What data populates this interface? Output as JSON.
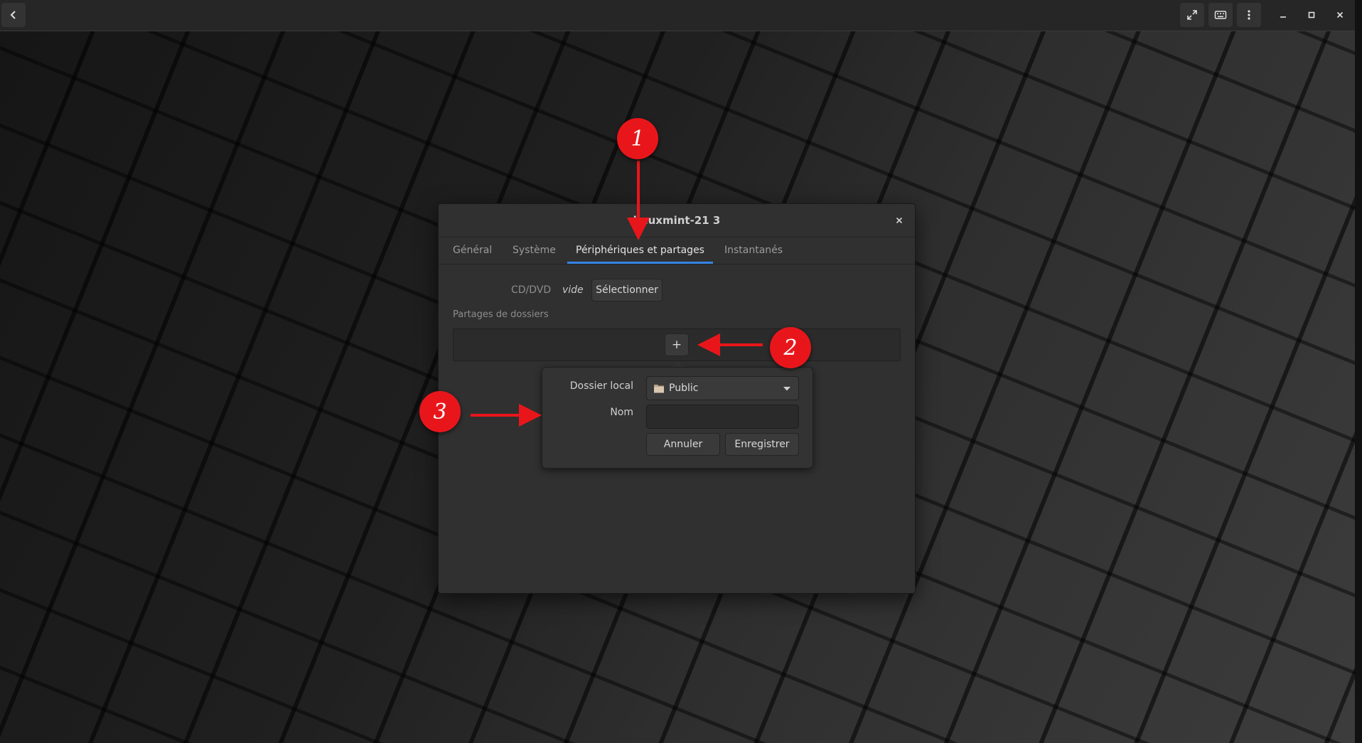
{
  "window": {
    "title": "linuxmint-21 3",
    "close_icon": "close-icon"
  },
  "tabs": [
    {
      "label": "Général",
      "active": false
    },
    {
      "label": "Système",
      "active": false
    },
    {
      "label": "Périphériques et partages",
      "active": true
    },
    {
      "label": "Instantanés",
      "active": false
    }
  ],
  "devices": {
    "cd_label": "CD/DVD",
    "cd_value": "vide",
    "select_button": "Sélectionner",
    "shares_heading": "Partages de dossiers",
    "add_button": "+"
  },
  "share_popover": {
    "local_folder_label": "Dossier local",
    "local_folder_value": "Public",
    "name_label": "Nom",
    "name_value": "",
    "cancel_button": "Annuler",
    "save_button": "Enregistrer"
  },
  "callouts": [
    "1",
    "2",
    "3"
  ],
  "colors": {
    "accent": "#3584e4",
    "callout": "#e8161b"
  }
}
